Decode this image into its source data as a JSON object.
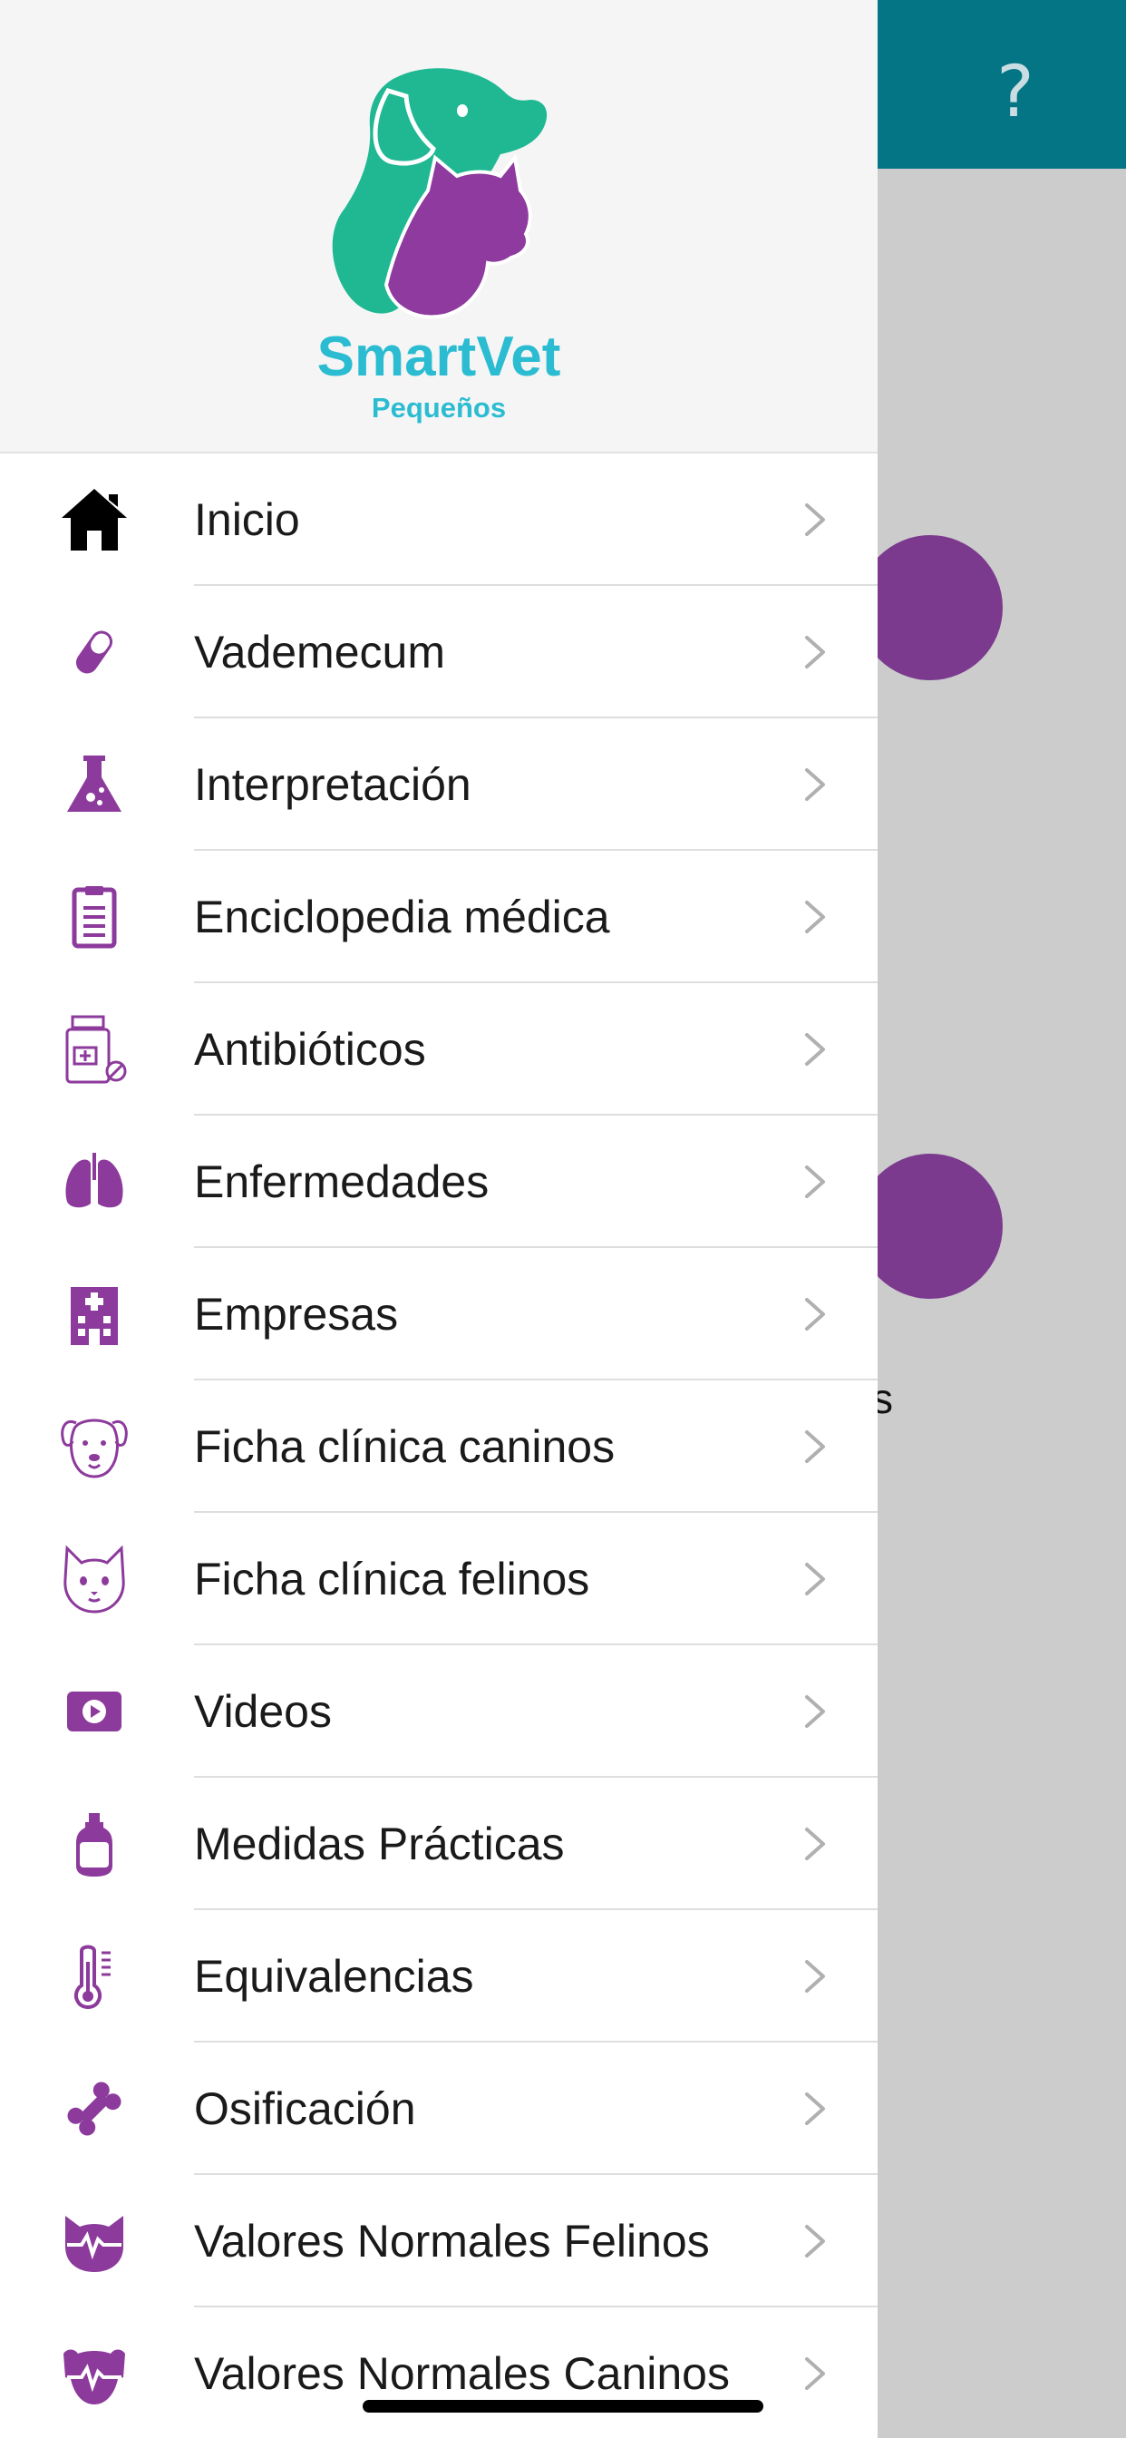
{
  "background": {
    "help_symbol": "?",
    "partial_text": "s",
    "topbar_color": "#037585",
    "fab_color": "#7b3a8e"
  },
  "drawer": {
    "brand_name": "SmartVet",
    "brand_subtitle": "Pequeños",
    "menu": [
      {
        "label": "Inicio",
        "icon": "home-icon"
      },
      {
        "label": "Vademecum",
        "icon": "pill-icon"
      },
      {
        "label": "Interpretación",
        "icon": "flask-icon"
      },
      {
        "label": "Enciclopedia médica",
        "icon": "clipboard-icon"
      },
      {
        "label": "Antibióticos",
        "icon": "medicine-bottle-icon"
      },
      {
        "label": "Enfermedades",
        "icon": "lungs-icon"
      },
      {
        "label": "Empresas",
        "icon": "hospital-building-icon"
      },
      {
        "label": "Ficha clínica caninos",
        "icon": "dog-face-icon"
      },
      {
        "label": "Ficha clínica felinos",
        "icon": "cat-face-icon"
      },
      {
        "label": "Videos",
        "icon": "video-play-icon"
      },
      {
        "label": "Medidas Prácticas",
        "icon": "flask-bottle-icon"
      },
      {
        "label": "Equivalencias",
        "icon": "thermometer-icon"
      },
      {
        "label": "Osificación",
        "icon": "bone-icon"
      },
      {
        "label": "Valores Normales Felinos",
        "icon": "cat-vitals-icon"
      },
      {
        "label": "Valores Normales Caninos",
        "icon": "dog-vitals-icon"
      }
    ]
  },
  "colors": {
    "accent_purple": "#8c3a9b",
    "brand_teal": "#2bbcd2",
    "logo_green": "#1fb893"
  }
}
